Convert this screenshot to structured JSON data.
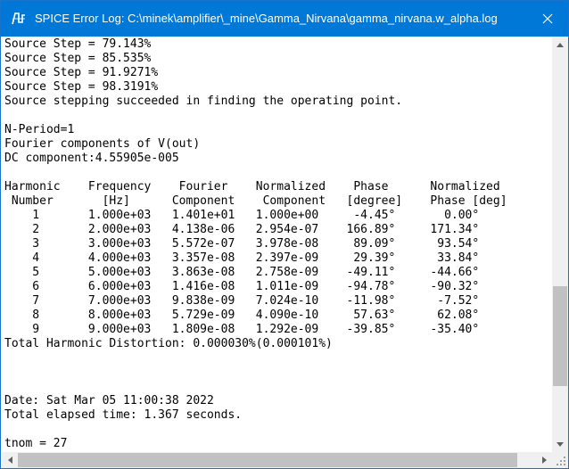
{
  "window": {
    "title": "SPICE Error Log: C:\\minek\\amplifier\\_mine\\Gamma_Nirvana\\gamma_nirvana.w_alpha.log",
    "icon": "ltspice-icon",
    "close_icon": "close-icon"
  },
  "log_lines": [
    "Source Step = 79.143%",
    "Source Step = 85.535%",
    "Source Step = 91.9271%",
    "Source Step = 98.3191%",
    "Source stepping succeeded in finding the operating point.",
    "",
    "N-Period=1",
    "Fourier components of V(out)",
    "DC component:4.55905e-005",
    "",
    "Harmonic    Frequency    Fourier    Normalized    Phase      Normalized",
    " Number       [Hz]      Component    Component   [degree]    Phase [deg]",
    "    1       1.000e+03   1.401e+01   1.000e+00     -4.45°       0.00°",
    "    2       2.000e+03   4.138e-06   2.954e-07    166.89°     171.34°",
    "    3       3.000e+03   5.572e-07   3.978e-08     89.09°      93.54°",
    "    4       4.000e+03   3.357e-08   2.397e-09     29.39°      33.84°",
    "    5       5.000e+03   3.863e-08   2.758e-09    -49.11°     -44.66°",
    "    6       6.000e+03   1.416e-08   1.011e-09    -94.78°     -90.32°",
    "    7       7.000e+03   9.838e-09   7.024e-10    -11.98°      -7.52°",
    "    8       8.000e+03   5.729e-09   4.090e-10     57.63°      62.08°",
    "    9       9.000e+03   1.809e-08   1.292e-09    -39.85°     -35.40°",
    "Total Harmonic Distortion: 0.000030%(0.000101%)",
    "",
    "",
    "",
    "Date: Sat Mar 05 11:00:38 2022",
    "Total elapsed time: 1.367 seconds.",
    "",
    "tnom = 27"
  ],
  "scrollbars": {
    "vertical_position": 0.78,
    "horizontal_position": 0.0
  }
}
